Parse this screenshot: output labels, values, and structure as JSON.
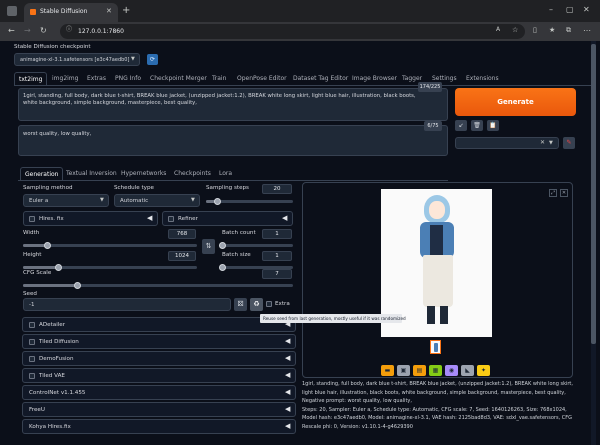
{
  "browser": {
    "tab_title": "Stable Diffusion",
    "url": "127.0.0.1:7860"
  },
  "checkpoint": {
    "label": "Stable Diffusion checkpoint",
    "value": "animagine-xl-3.1.safetensors [e3c47aedb0]"
  },
  "main_tabs": [
    "txt2img",
    "img2img",
    "Extras",
    "PNG Info",
    "Checkpoint Merger",
    "Train",
    "OpenPose Editor",
    "Dataset Tag Editor",
    "Image Browser",
    "Tagger",
    "Settings",
    "Extensions"
  ],
  "prompt": {
    "value": "1girl, standing, full body, dark blue t-shirt, BREAK blue jacket, (unzipped jacket:1.2), BREAK white long skirt, light blue hair, illustration, black boots, white background, simple background, masterpiece, best quality,",
    "token_count": "174/225"
  },
  "negative_prompt": {
    "value": "worst quality, low quality,",
    "token_count": "6/75"
  },
  "generate_label": "Generate",
  "sub_tabs": [
    "Generation",
    "Textual Inversion",
    "Hypernetworks",
    "Checkpoints",
    "Lora"
  ],
  "sampling": {
    "method_label": "Sampling method",
    "method_value": "Euler a",
    "schedule_label": "Schedule type",
    "schedule_value": "Automatic",
    "steps_label": "Sampling steps",
    "steps_value": "20",
    "steps_fraction": 0.13
  },
  "hires_label": "Hires. fix",
  "refiner_label": "Refiner",
  "width": {
    "label": "Width",
    "value": "768",
    "fraction": 0.14
  },
  "height": {
    "label": "Height",
    "value": "1024",
    "fraction": 0.2
  },
  "batch_count": {
    "label": "Batch count",
    "value": "1",
    "fraction": 0.0
  },
  "batch_size": {
    "label": "Batch size",
    "value": "1",
    "fraction": 0.0
  },
  "cfg": {
    "label": "CFG Scale",
    "value": "7",
    "fraction": 0.2
  },
  "seed": {
    "label": "Seed",
    "value": "-1",
    "extra_label": "Extra"
  },
  "tooltip": "Reuse seed from last generation, mostly useful if it was randomized",
  "accordions": [
    "ADetailer",
    "Tiled Diffusion",
    "DemoFusion",
    "Tiled VAE",
    "ControlNet v1.1.455",
    "FreeU",
    "Kohya Hires.fix"
  ],
  "output_info": "1girl, standing, full body, dark blue t-shirt, BREAK blue jacket, (unzipped jacket:1.2), BREAK white long skirt, light blue hair, illustration, black boots, white background, simple background, masterpiece, best quality,\nNegative prompt: worst quality, low quality,\nSteps: 20, Sampler: Euler a, Schedule type: Automatic, CFG scale: 7, Seed: 1640126263, Size: 768x1024, Model hash: e3c47aedb0, Model: animagine-xl-3.1, VAE hash: 2125bad8d3, VAE: sdxl_vae.safetensors, CFG Rescale phi: 0, Version: v1.10.1-4-g4629390"
}
